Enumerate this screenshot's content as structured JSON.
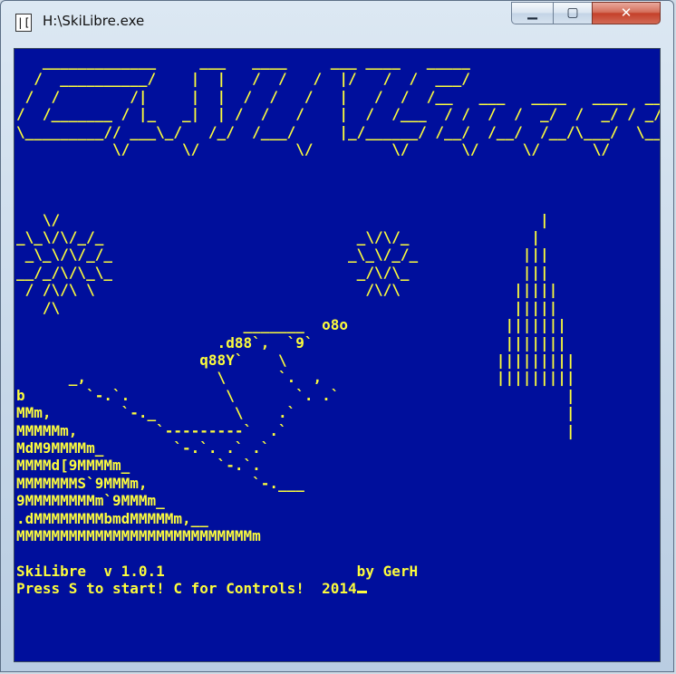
{
  "window": {
    "title": "H:\\SkiLibre.exe",
    "icon_name": "console-app-icon",
    "controls": {
      "minimize_icon": "minimize-icon",
      "maximize_icon": "maximize-icon",
      "close_icon": "close-icon",
      "minimize_glyph": "▁",
      "maximize_glyph": "▢",
      "close_glyph": "✕"
    }
  },
  "console": {
    "background": "#000f9c",
    "foreground": "#fcfc3c",
    "logo_art": "   _____________     ___   ____     ___ ____   _____\n  /  __________/    |  |   /  /   /  |/   /  /  ___/\n /  /        /|     |  |  /  /   /   |   /  /  /__   ___   ____   ____  ___\n/  /_______ / |_   _|  | /  /   /    |  /  /___  / /  /  /  _/  /  _/ / _/\n\\_________// ___\\_/   /_/  /___/     |_/______/ /__/  /__/  /__/\\___/  \\__/\n           \\/      \\/           \\/         \\/      \\/     \\/      \\/",
    "scene_art": "\n\n\n   \\/                                                       |\n_\\_\\/\\/_/_                             _\\/\\/_              |\n _\\_\\/\\/_/_                           _\\_\\/_/_            |||\n__/_/\\/\\_\\_                            _/\\/\\_             |||\n / /\\/\\ \\                               /\\/\\             |||||\n   /\\                                                    |||||\n                          _______  o8o                  |||||||\n                       .d88`,  `9`                      |||||||\n                     q88Y`    \\                        |||||||||\n      _,               \\      `.  ,                    |||||||||\nb       `-.`.           \\       `. .`                          |\nMMm,        `-._         \\    .`                               |\nMMMMMm,         `---------`  .`                                |\nMdM9MMMMm_        `-.`. .` .`\nMMMMd[9MMMMm_          `-.`.\nMMMMMMMS`9MMMm,            `-.___\n9MMMMMMMMm`9MMMm_\n.dMMMMMMMMbmdMMMMMm,__\nMMMMMMMMMMMMMMMMMMMMMMMMMMMm",
    "status_line_1": "SkiLibre  v 1.0.1                      by GerH",
    "status_line_2": "Press S to start! C for Controls!  2014"
  }
}
